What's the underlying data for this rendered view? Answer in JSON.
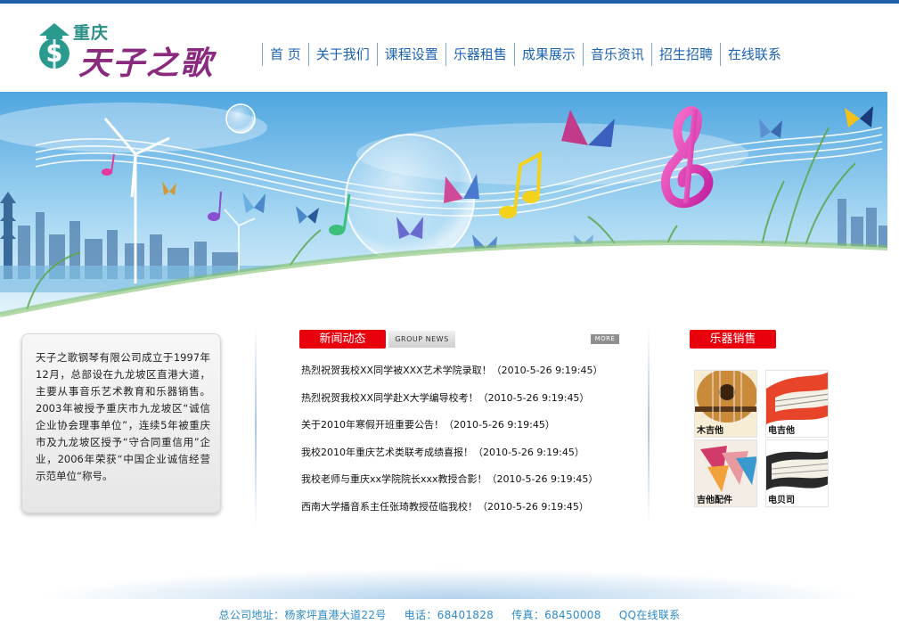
{
  "header": {
    "logo_small": "重庆",
    "logo_big": "天子之歌"
  },
  "nav": {
    "items": [
      "首 页",
      "关于我们",
      "课程设置",
      "乐器租售",
      "成果展示",
      "音乐资讯",
      "招生招聘",
      "在线联系"
    ]
  },
  "about": {
    "text": "天子之歌钢琴有限公司成立于1997年12月，总部设在九龙坡区直港大道，主要从事音乐艺术教育和乐器销售。2003年被授予重庆市九龙坡区“诚信企业协会理事单位”，连续5年被重庆市及九龙坡区授予“守合同重信用”企业，2006年荣获“中国企业诚信经营示范单位“称号。"
  },
  "news": {
    "tab_label": "新闻动态",
    "tab_en": "GROUP NEWS",
    "more_label": "MORE",
    "items": [
      "热烈祝贺我校XX同学被XXX艺术学院录取！（2010-5-26 9:19:45）",
      "热烈祝贺我校XX同学赴X大学编导校考！（2010-5-26 9:19:45）",
      "关于2010年寒假开班重要公告！（2010-5-26 9:19:45）",
      "我校2010年重庆艺术类联考成绩喜报！（2010-5-26 9:19:45）",
      "我校老师与重庆xx学院院长xxx教授合影！（2010-5-26 9:19:45）",
      "西南大学播音系主任张琦教授莅临我校！（2010-5-26 9:19:45）"
    ]
  },
  "products": {
    "tab_label": "乐器销售",
    "items": [
      "木吉他",
      "电吉他",
      "吉他配件",
      "电贝司"
    ]
  },
  "footer": {
    "address": "总公司地址：杨家坪直港大道22号",
    "phone": "电话：68401828",
    "fax": "传真：68450008",
    "qq": "QQ在线联系"
  },
  "colors": {
    "accent_red": "#e8000c",
    "nav_blue": "#1b63b0",
    "footer_blue": "#2d8ac9"
  }
}
